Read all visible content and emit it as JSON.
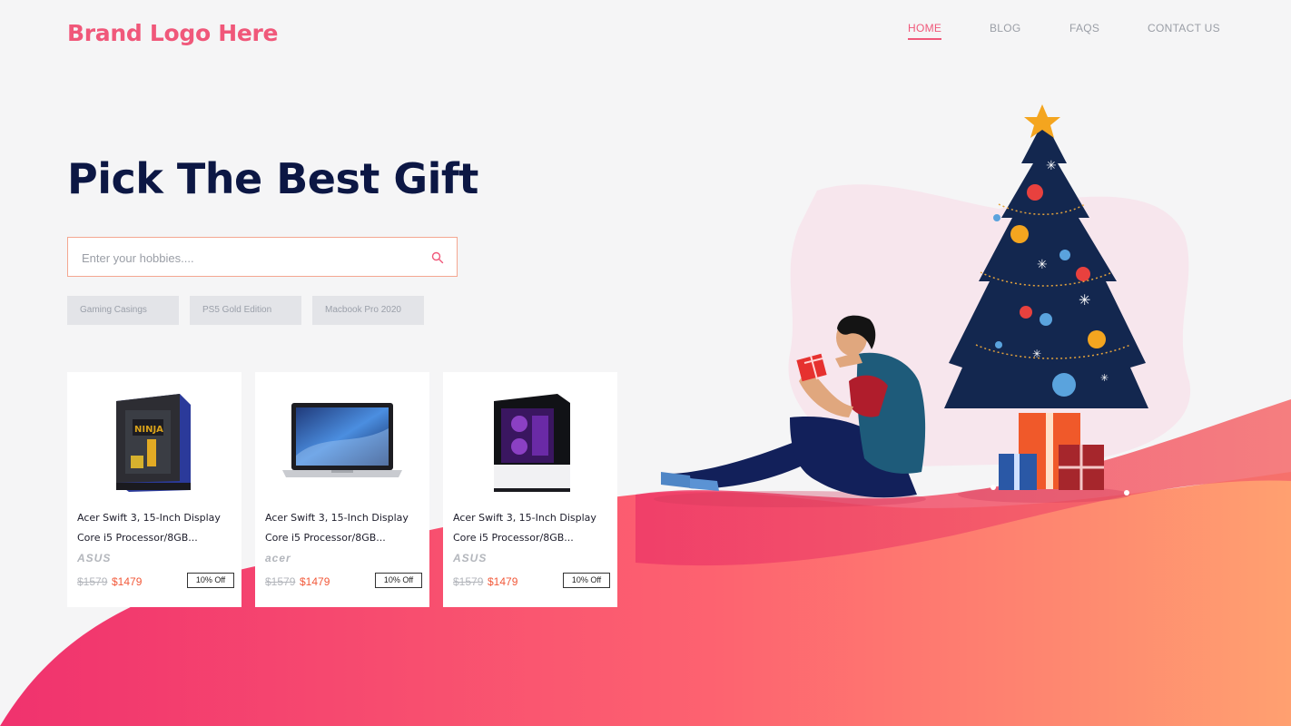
{
  "header": {
    "brand": "Brand Logo Here",
    "nav": [
      {
        "label": "HOME",
        "active": true
      },
      {
        "label": "BLOG",
        "active": false
      },
      {
        "label": "FAQS",
        "active": false
      },
      {
        "label": "CONTACT US",
        "active": false
      }
    ]
  },
  "hero": {
    "title": "Pick The Best Gift",
    "search": {
      "placeholder": "Enter your hobbies....",
      "value": ""
    },
    "tags": [
      "Gaming Casings",
      "PS5 Gold Edition",
      "Macbook Pro 2020"
    ]
  },
  "products": [
    {
      "title_line1": "Acer Swift 3, 15-Inch Display",
      "title_line2": "Core i5 Processor/8GB...",
      "brand": "ASUS",
      "old_price": "$1579",
      "price": "$1479",
      "discount": "10% Off",
      "image": "gaming-pc-case-icon"
    },
    {
      "title_line1": "Acer Swift 3, 15-Inch Display",
      "title_line2": "Core i5 Processor/8GB...",
      "brand": "acer",
      "old_price": "$1579",
      "price": "$1479",
      "discount": "10% Off",
      "image": "laptop-icon"
    },
    {
      "title_line1": "Acer Swift 3, 15-Inch Display",
      "title_line2": "Core i5 Processor/8GB...",
      "brand": "ASUS",
      "old_price": "$1579",
      "price": "$1479",
      "discount": "10% Off",
      "image": "pc-tower-icon"
    }
  ],
  "colors": {
    "brand": "#f0587a",
    "title": "#0c1744",
    "price": "#f25a3b",
    "wave_start": "#f0326e",
    "wave_end": "#ffa070"
  }
}
